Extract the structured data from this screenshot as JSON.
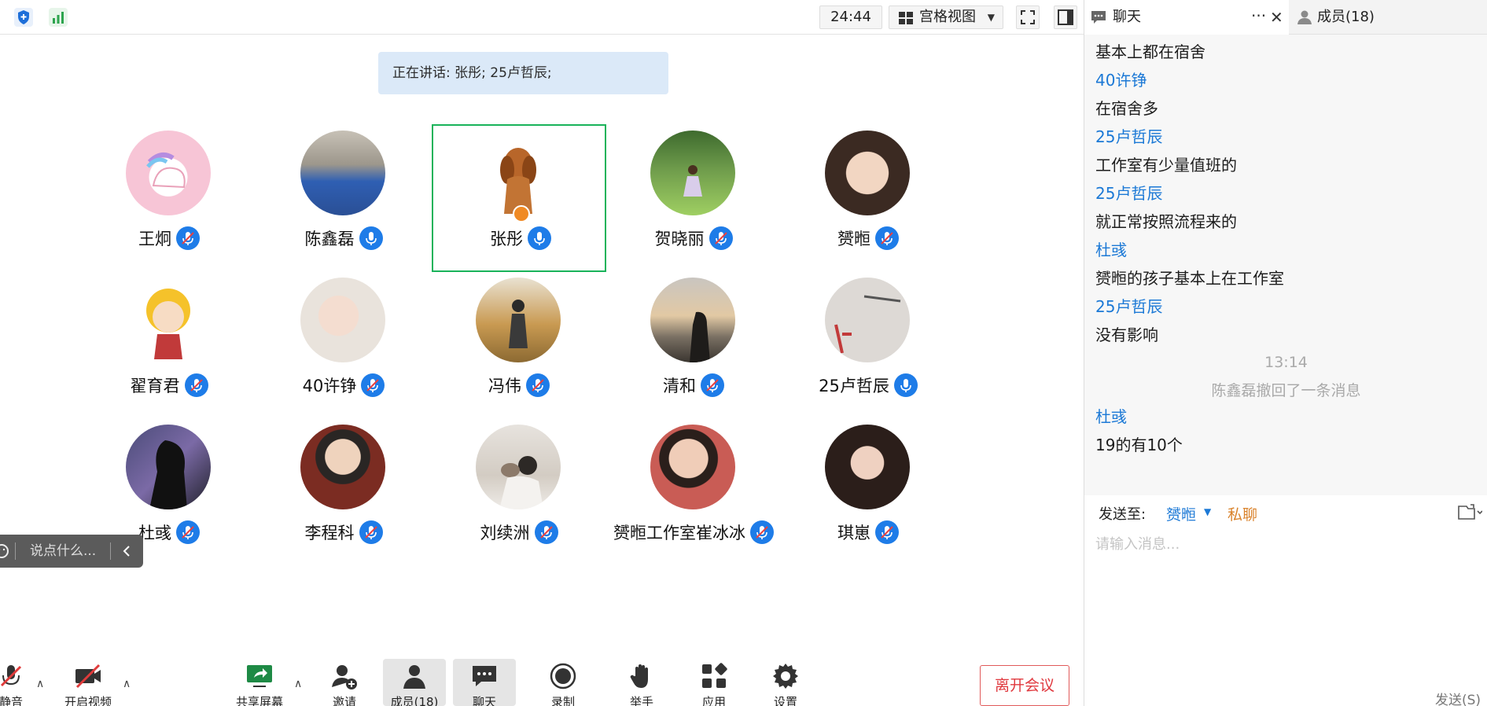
{
  "topbar": {
    "timer": "24:44",
    "view_label": "宫格视图"
  },
  "speaking": "正在讲话: 张彤; 25卢哲辰;",
  "participants": [
    {
      "name": "王炯"
    },
    {
      "name": "陈鑫磊"
    },
    {
      "name": "张彤"
    },
    {
      "name": "贺晓丽"
    },
    {
      "name": "赟暅"
    },
    {
      "name": "翟育君"
    },
    {
      "name": "40许铮"
    },
    {
      "name": "冯伟"
    },
    {
      "name": "清和"
    },
    {
      "name": "25卢哲辰"
    },
    {
      "name": "杜彧"
    },
    {
      "name": "李程科"
    },
    {
      "name": "刘续洲"
    },
    {
      "name": "赟暅工作室崔冰冰"
    },
    {
      "name": "琪崽"
    }
  ],
  "float_chat": {
    "placeholder": "说点什么..."
  },
  "toolbar": {
    "mute": "静音",
    "video": "开启视频",
    "share": "共享屏幕",
    "invite": "邀请",
    "members": "成员(18)",
    "chat": "聊天",
    "record": "录制",
    "raise_hand": "举手",
    "apps": "应用",
    "settings": "设置",
    "leave": "离开会议"
  },
  "panel": {
    "tab_chat": "聊天",
    "tab_members": "成员(18)",
    "messages": [
      {
        "kind": "text",
        "content": "基本上都在宿舍"
      },
      {
        "kind": "sender",
        "content": "40许铮"
      },
      {
        "kind": "text",
        "content": "在宿舍多"
      },
      {
        "kind": "sender",
        "content": "25卢哲辰"
      },
      {
        "kind": "text",
        "content": "工作室有少量值班的"
      },
      {
        "kind": "sender",
        "content": "25卢哲辰"
      },
      {
        "kind": "text",
        "content": "就正常按照流程来的"
      },
      {
        "kind": "sender",
        "content": "杜彧"
      },
      {
        "kind": "text",
        "content": "赟暅的孩子基本上在工作室"
      },
      {
        "kind": "sender",
        "content": "25卢哲辰"
      },
      {
        "kind": "text",
        "content": "没有影响"
      },
      {
        "kind": "sys",
        "content": "13:14"
      },
      {
        "kind": "sys",
        "content": "陈鑫磊撤回了一条消息"
      },
      {
        "kind": "sender",
        "content": "杜彧"
      },
      {
        "kind": "text",
        "content": "19的有10个"
      }
    ],
    "send_to_label": "发送至:",
    "send_to_target": "赟暅",
    "private_label": "私聊",
    "input_placeholder": "请输入消息...",
    "send_button": "发送(S)"
  }
}
